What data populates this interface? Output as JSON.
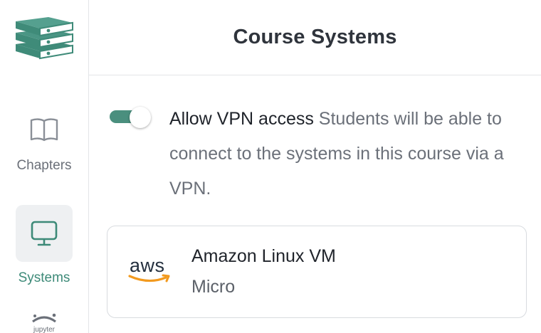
{
  "sidebar": {
    "items": [
      {
        "label": "Chapters",
        "icon": "book-open-icon"
      },
      {
        "label": "Systems",
        "icon": "monitor-icon",
        "active": true
      },
      {
        "label": "Jupyter",
        "icon": "jupyter-icon"
      }
    ]
  },
  "header": {
    "title": "Course Systems"
  },
  "vpn": {
    "enabled": true,
    "label": "Allow VPN access",
    "description": " Students will be able to connect to the systems in this course via a VPN."
  },
  "systems": [
    {
      "name": "Amazon Linux VM",
      "size": "Micro",
      "provider_logo_text": "aws"
    }
  ],
  "colors": {
    "accent": "#3d8a78",
    "toggle_on": "#4a8f7e",
    "aws_orange": "#f29a1f",
    "border": "#e3e5e8"
  }
}
